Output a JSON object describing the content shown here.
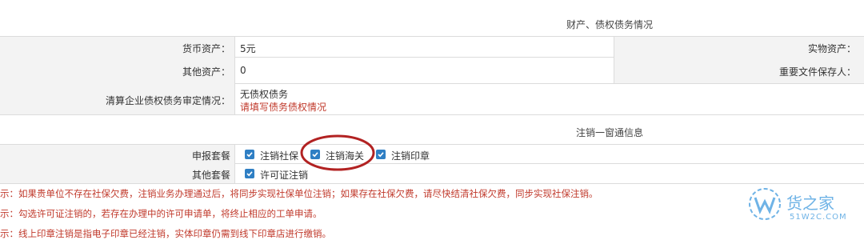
{
  "sections": {
    "assets_title": "财产、债权债务情况",
    "one_window_title": "注销一窗通信息"
  },
  "assets": {
    "monetary_label": "货币资产：",
    "monetary_value": "5元",
    "physical_label": "实物资产：",
    "other_label": "其他资产：",
    "other_value": "0",
    "keeper_label": "重要文件保存人：",
    "debt_label": "清算企业债权债务审定情况：",
    "debt_value": "无债权债务",
    "debt_link": "请填写债务债权情况"
  },
  "packages": {
    "declare_label": "申报套餐",
    "declare_items": [
      {
        "label": "注销社保",
        "checked": true
      },
      {
        "label": "注销海关",
        "checked": true
      },
      {
        "label": "注销印章",
        "checked": true
      }
    ],
    "other_label": "其他套餐",
    "other_items": [
      {
        "label": "许可证注销",
        "checked": true
      }
    ]
  },
  "tips": [
    "示：如果贵单位不存在社保欠费，注销业务办理通过后，将同步实现社保单位注销；如果存在社保欠费，请尽快结清社保欠费，同步实现社保注销。",
    "示：勾选许可证注销的，若存在办理中的许可申请单，将终止相应的工单申请。",
    "示：线上印章注销是指电子印章已经注销，实体印章仍需到线下印章店进行缴销。"
  ],
  "watermark": {
    "brand": "货之家",
    "site": "51W2C.COM"
  },
  "colors": {
    "checkbox": "#2f7fc4",
    "tip_red": "#c0392b",
    "annotation_circle": "#b22222",
    "watermark_blue": "#6fb3e6"
  }
}
